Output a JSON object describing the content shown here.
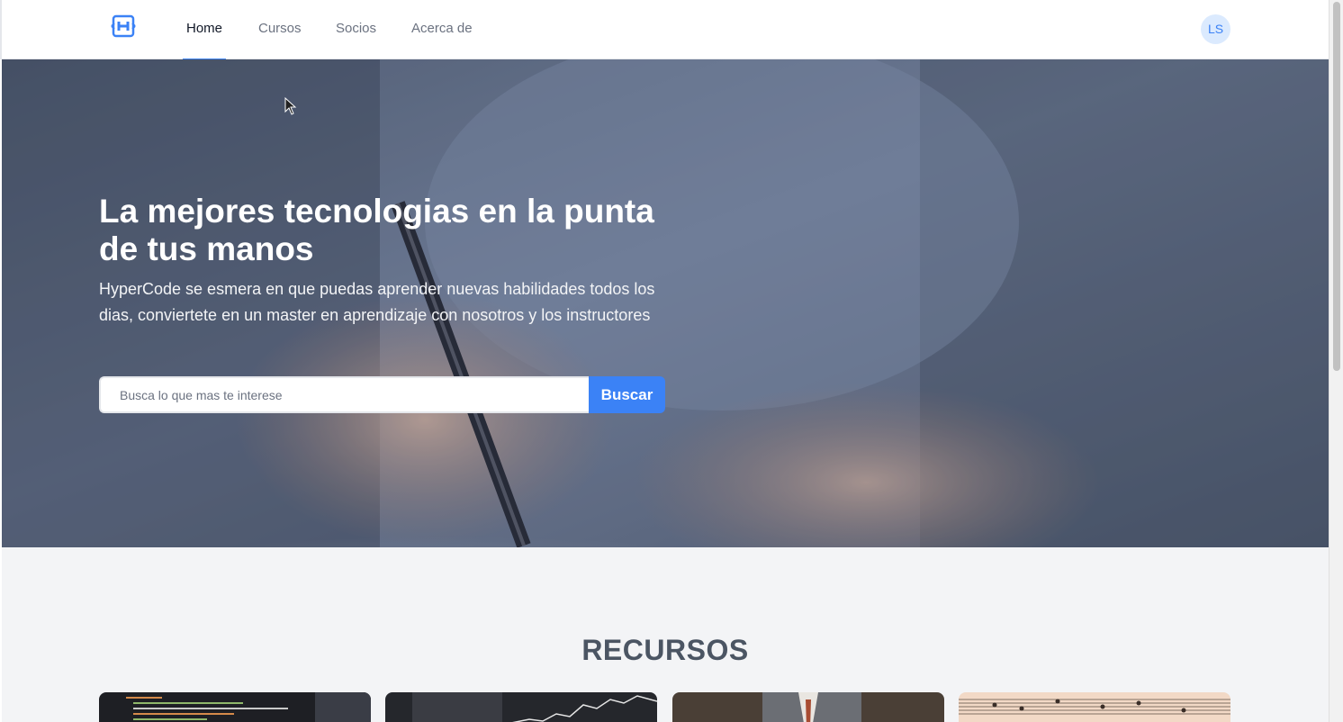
{
  "nav": {
    "links": [
      {
        "label": "Home",
        "active": true
      },
      {
        "label": "Cursos",
        "active": false
      },
      {
        "label": "Socios",
        "active": false
      },
      {
        "label": "Acerca de",
        "active": false
      }
    ],
    "avatar_initials": "LS",
    "logo_icon": "hypercode-logo-icon"
  },
  "hero": {
    "title": "La mejores tecnologias en la punta de tus manos",
    "subtitle": "HyperCode se esmera en que puedas aprender nuevas habilidades todos los dias, conviertete en un master en aprendizaje con nosotros y los instructores",
    "search_placeholder": "Busca lo que mas te interese",
    "search_button": "Buscar"
  },
  "resources": {
    "title": "RECURSOS",
    "cards": [
      {
        "image": "code-editor-image"
      },
      {
        "image": "stock-chart-image"
      },
      {
        "image": "business-person-image"
      },
      {
        "image": "sheet-music-image"
      }
    ]
  },
  "colors": {
    "accent": "#3b82f6",
    "avatar_bg": "#dbeafe",
    "section_bg": "#f3f4f6"
  }
}
